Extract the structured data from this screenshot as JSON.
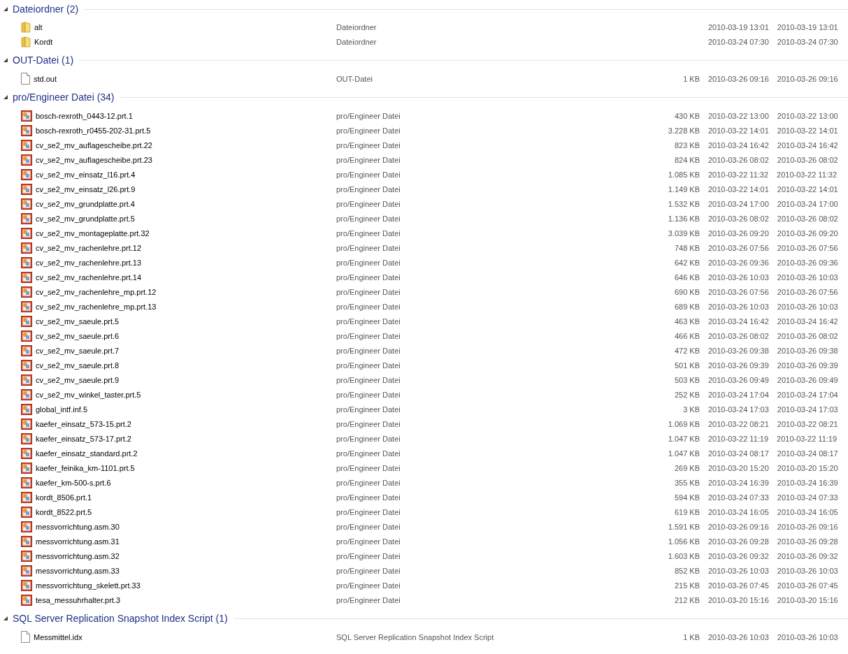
{
  "groups": [
    {
      "title": "Dateiordner (2)",
      "expanded": true,
      "items": [
        {
          "kind": "folder",
          "name": "alt",
          "type": "Dateiordner",
          "date_1": "2010-03-19 13:01",
          "date_2": "2010-03-19 13:01"
        },
        {
          "kind": "folder",
          "name": "Kordt",
          "type": "Dateiordner",
          "date_1": "2010-03-24 07:30",
          "date_2": "2010-03-24 07:30"
        }
      ]
    },
    {
      "title": "OUT-Datei (1)",
      "expanded": true,
      "items": [
        {
          "kind": "file",
          "name": "std.out",
          "type": "OUT-Datei",
          "size": "1 KB",
          "date_1": "2010-03-26 09:16",
          "date_2": "2010-03-26 09:16"
        }
      ]
    },
    {
      "title": "pro/Engineer Datei (34)",
      "expanded": true,
      "items": [
        {
          "kind": "model",
          "name": "bosch-rexroth_0443-12.prt.1",
          "type": "pro/Engineer Datei",
          "size": "430 KB",
          "date_1": "2010-03-22 13:00",
          "date_2": "2010-03-22 13:00"
        },
        {
          "kind": "model",
          "name": "bosch-rexroth_r0455-202-31.prt.5",
          "type": "pro/Engineer Datei",
          "size": "3.228 KB",
          "date_1": "2010-03-22 14:01",
          "date_2": "2010-03-22 14:01"
        },
        {
          "kind": "model",
          "name": "cv_se2_mv_auflagescheibe.prt.22",
          "type": "pro/Engineer Datei",
          "size": "823 KB",
          "date_1": "2010-03-24 16:42",
          "date_2": "2010-03-24 16:42"
        },
        {
          "kind": "model",
          "name": "cv_se2_mv_auflagescheibe.prt.23",
          "type": "pro/Engineer Datei",
          "size": "824 KB",
          "date_1": "2010-03-26 08:02",
          "date_2": "2010-03-26 08:02"
        },
        {
          "kind": "model",
          "name": "cv_se2_mv_einsatz_l16.prt.4",
          "type": "pro/Engineer Datei",
          "size": "1.085 KB",
          "date_1": "2010-03-22 11:32",
          "date_2": "2010-03-22 11:32"
        },
        {
          "kind": "model",
          "name": "cv_se2_mv_einsatz_l26.prt.9",
          "type": "pro/Engineer Datei",
          "size": "1.149 KB",
          "date_1": "2010-03-22 14:01",
          "date_2": "2010-03-22 14:01"
        },
        {
          "kind": "model",
          "name": "cv_se2_mv_grundplatte.prt.4",
          "type": "pro/Engineer Datei",
          "size": "1.532 KB",
          "date_1": "2010-03-24 17:00",
          "date_2": "2010-03-24 17:00"
        },
        {
          "kind": "model",
          "name": "cv_se2_mv_grundplatte.prt.5",
          "type": "pro/Engineer Datei",
          "size": "1.136 KB",
          "date_1": "2010-03-26 08:02",
          "date_2": "2010-03-26 08:02"
        },
        {
          "kind": "model",
          "name": "cv_se2_mv_montageplatte.prt.32",
          "type": "pro/Engineer Datei",
          "size": "3.039 KB",
          "date_1": "2010-03-26 09:20",
          "date_2": "2010-03-26 09:20"
        },
        {
          "kind": "model",
          "name": "cv_se2_mv_rachenlehre.prt.12",
          "type": "pro/Engineer Datei",
          "size": "748 KB",
          "date_1": "2010-03-26 07:56",
          "date_2": "2010-03-26 07:56"
        },
        {
          "kind": "model",
          "name": "cv_se2_mv_rachenlehre.prt.13",
          "type": "pro/Engineer Datei",
          "size": "642 KB",
          "date_1": "2010-03-26 09:36",
          "date_2": "2010-03-26 09:36"
        },
        {
          "kind": "model",
          "name": "cv_se2_mv_rachenlehre.prt.14",
          "type": "pro/Engineer Datei",
          "size": "646 KB",
          "date_1": "2010-03-26 10:03",
          "date_2": "2010-03-26 10:03"
        },
        {
          "kind": "model",
          "name": "cv_se2_mv_rachenlehre_mp.prt.12",
          "type": "pro/Engineer Datei",
          "size": "690 KB",
          "date_1": "2010-03-26 07:56",
          "date_2": "2010-03-26 07:56"
        },
        {
          "kind": "model",
          "name": "cv_se2_mv_rachenlehre_mp.prt.13",
          "type": "pro/Engineer Datei",
          "size": "689 KB",
          "date_1": "2010-03-26 10:03",
          "date_2": "2010-03-26 10:03"
        },
        {
          "kind": "model",
          "name": "cv_se2_mv_saeule.prt.5",
          "type": "pro/Engineer Datei",
          "size": "463 KB",
          "date_1": "2010-03-24 16:42",
          "date_2": "2010-03-24 16:42"
        },
        {
          "kind": "model",
          "name": "cv_se2_mv_saeule.prt.6",
          "type": "pro/Engineer Datei",
          "size": "466 KB",
          "date_1": "2010-03-26 08:02",
          "date_2": "2010-03-26 08:02"
        },
        {
          "kind": "model",
          "name": "cv_se2_mv_saeule.prt.7",
          "type": "pro/Engineer Datei",
          "size": "472 KB",
          "date_1": "2010-03-26 09:38",
          "date_2": "2010-03-26 09:38"
        },
        {
          "kind": "model",
          "name": "cv_se2_mv_saeule.prt.8",
          "type": "pro/Engineer Datei",
          "size": "501 KB",
          "date_1": "2010-03-26 09:39",
          "date_2": "2010-03-26 09:39"
        },
        {
          "kind": "model",
          "name": "cv_se2_mv_saeule.prt.9",
          "type": "pro/Engineer Datei",
          "size": "503 KB",
          "date_1": "2010-03-26 09:49",
          "date_2": "2010-03-26 09:49"
        },
        {
          "kind": "model",
          "name": "cv_se2_mv_winkel_taster.prt.5",
          "type": "pro/Engineer Datei",
          "size": "252 KB",
          "date_1": "2010-03-24 17:04",
          "date_2": "2010-03-24 17:04"
        },
        {
          "kind": "model",
          "name": "global_intf.inf.5",
          "type": "pro/Engineer Datei",
          "size": "3 KB",
          "date_1": "2010-03-24 17:03",
          "date_2": "2010-03-24 17:03"
        },
        {
          "kind": "model",
          "name": "kaefer_einsatz_573-15.prt.2",
          "type": "pro/Engineer Datei",
          "size": "1.069 KB",
          "date_1": "2010-03-22 08:21",
          "date_2": "2010-03-22 08:21"
        },
        {
          "kind": "model",
          "name": "kaefer_einsatz_573-17.prt.2",
          "type": "pro/Engineer Datei",
          "size": "1.047 KB",
          "date_1": "2010-03-22 11:19",
          "date_2": "2010-03-22 11:19"
        },
        {
          "kind": "model",
          "name": "kaefer_einsatz_standard.prt.2",
          "type": "pro/Engineer Datei",
          "size": "1.047 KB",
          "date_1": "2010-03-24 08:17",
          "date_2": "2010-03-24 08:17"
        },
        {
          "kind": "model",
          "name": "kaefer_feinika_km-1101.prt.5",
          "type": "pro/Engineer Datei",
          "size": "269 KB",
          "date_1": "2010-03-20 15:20",
          "date_2": "2010-03-20 15:20"
        },
        {
          "kind": "model",
          "name": "kaefer_km-500-s.prt.6",
          "type": "pro/Engineer Datei",
          "size": "355 KB",
          "date_1": "2010-03-24 16:39",
          "date_2": "2010-03-24 16:39"
        },
        {
          "kind": "model",
          "name": "kordt_8506.prt.1",
          "type": "pro/Engineer Datei",
          "size": "594 KB",
          "date_1": "2010-03-24 07:33",
          "date_2": "2010-03-24 07:33"
        },
        {
          "kind": "model",
          "name": "kordt_8522.prt.5",
          "type": "pro/Engineer Datei",
          "size": "619 KB",
          "date_1": "2010-03-24 16:05",
          "date_2": "2010-03-24 16:05"
        },
        {
          "kind": "model",
          "name": "messvorrichtung.asm.30",
          "type": "pro/Engineer Datei",
          "size": "1.591 KB",
          "date_1": "2010-03-26 09:16",
          "date_2": "2010-03-26 09:16"
        },
        {
          "kind": "model",
          "name": "messvorrichtung.asm.31",
          "type": "pro/Engineer Datei",
          "size": "1.056 KB",
          "date_1": "2010-03-26 09:28",
          "date_2": "2010-03-26 09:28"
        },
        {
          "kind": "model",
          "name": "messvorrichtung.asm.32",
          "type": "pro/Engineer Datei",
          "size": "1.603 KB",
          "date_1": "2010-03-26 09:32",
          "date_2": "2010-03-26 09:32"
        },
        {
          "kind": "model",
          "name": "messvorrichtung.asm.33",
          "type": "pro/Engineer Datei",
          "size": "852 KB",
          "date_1": "2010-03-26 10:03",
          "date_2": "2010-03-26 10:03"
        },
        {
          "kind": "model",
          "name": "messvorrichtung_skelett.prt.33",
          "type": "pro/Engineer Datei",
          "size": "215 KB",
          "date_1": "2010-03-26 07:45",
          "date_2": "2010-03-26 07:45"
        },
        {
          "kind": "model",
          "name": "tesa_messuhrhalter.prt.3",
          "type": "pro/Engineer Datei",
          "size": "212 KB",
          "date_1": "2010-03-20 15:16",
          "date_2": "2010-03-20 15:16"
        }
      ]
    },
    {
      "title": "SQL Server Replication Snapshot Index Script (1)",
      "expanded": true,
      "items": [
        {
          "kind": "file",
          "name": "Messmittel.idx",
          "type": "SQL Server Replication Snapshot Index Script",
          "size": "1 KB",
          "date_1": "2010-03-26 10:03",
          "date_2": "2010-03-26 10:03"
        }
      ]
    }
  ]
}
